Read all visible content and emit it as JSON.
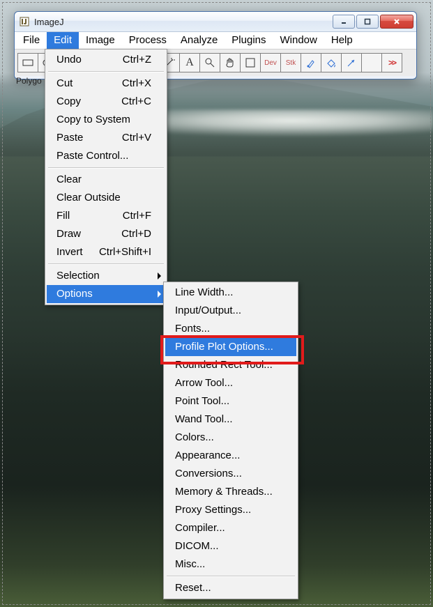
{
  "window": {
    "title": "ImageJ",
    "controls": {
      "minimize": "–",
      "maximize": "▢",
      "close": "X"
    }
  },
  "menubar": {
    "items": [
      {
        "label": "File"
      },
      {
        "label": "Edit",
        "active": true
      },
      {
        "label": "Image"
      },
      {
        "label": "Process"
      },
      {
        "label": "Analyze"
      },
      {
        "label": "Plugins"
      },
      {
        "label": "Window"
      },
      {
        "label": "Help"
      }
    ]
  },
  "statusbar": {
    "text": "Polygo"
  },
  "toolbar": {
    "dev_label": "Dev",
    "stk_label": "Stk",
    "more": ">>"
  },
  "edit_menu": {
    "groups": [
      [
        {
          "label": "Undo",
          "shortcut": "Ctrl+Z"
        }
      ],
      [
        {
          "label": "Cut",
          "shortcut": "Ctrl+X"
        },
        {
          "label": "Copy",
          "shortcut": "Ctrl+C"
        },
        {
          "label": "Copy to System",
          "shortcut": ""
        },
        {
          "label": "Paste",
          "shortcut": "Ctrl+V"
        },
        {
          "label": "Paste Control...",
          "shortcut": ""
        }
      ],
      [
        {
          "label": "Clear",
          "shortcut": ""
        },
        {
          "label": "Clear Outside",
          "shortcut": ""
        },
        {
          "label": "Fill",
          "shortcut": "Ctrl+F"
        },
        {
          "label": "Draw",
          "shortcut": "Ctrl+D"
        },
        {
          "label": "Invert",
          "shortcut": "Ctrl+Shift+I"
        }
      ],
      [
        {
          "label": "Selection",
          "sub": true
        },
        {
          "label": "Options",
          "sub": true,
          "active": true
        }
      ]
    ]
  },
  "options_menu": {
    "groups": [
      [
        {
          "label": "Line Width..."
        },
        {
          "label": "Input/Output..."
        },
        {
          "label": "Fonts..."
        },
        {
          "label": "Profile Plot Options...",
          "highlight": true
        },
        {
          "label": "Rounded Rect Tool..."
        },
        {
          "label": "Arrow Tool..."
        },
        {
          "label": "Point Tool..."
        },
        {
          "label": "Wand Tool..."
        },
        {
          "label": "Colors..."
        },
        {
          "label": "Appearance..."
        },
        {
          "label": "Conversions..."
        },
        {
          "label": "Memory & Threads..."
        },
        {
          "label": "Proxy Settings..."
        },
        {
          "label": "Compiler..."
        },
        {
          "label": "DICOM..."
        },
        {
          "label": "Misc..."
        }
      ],
      [
        {
          "label": "Reset..."
        }
      ]
    ]
  }
}
